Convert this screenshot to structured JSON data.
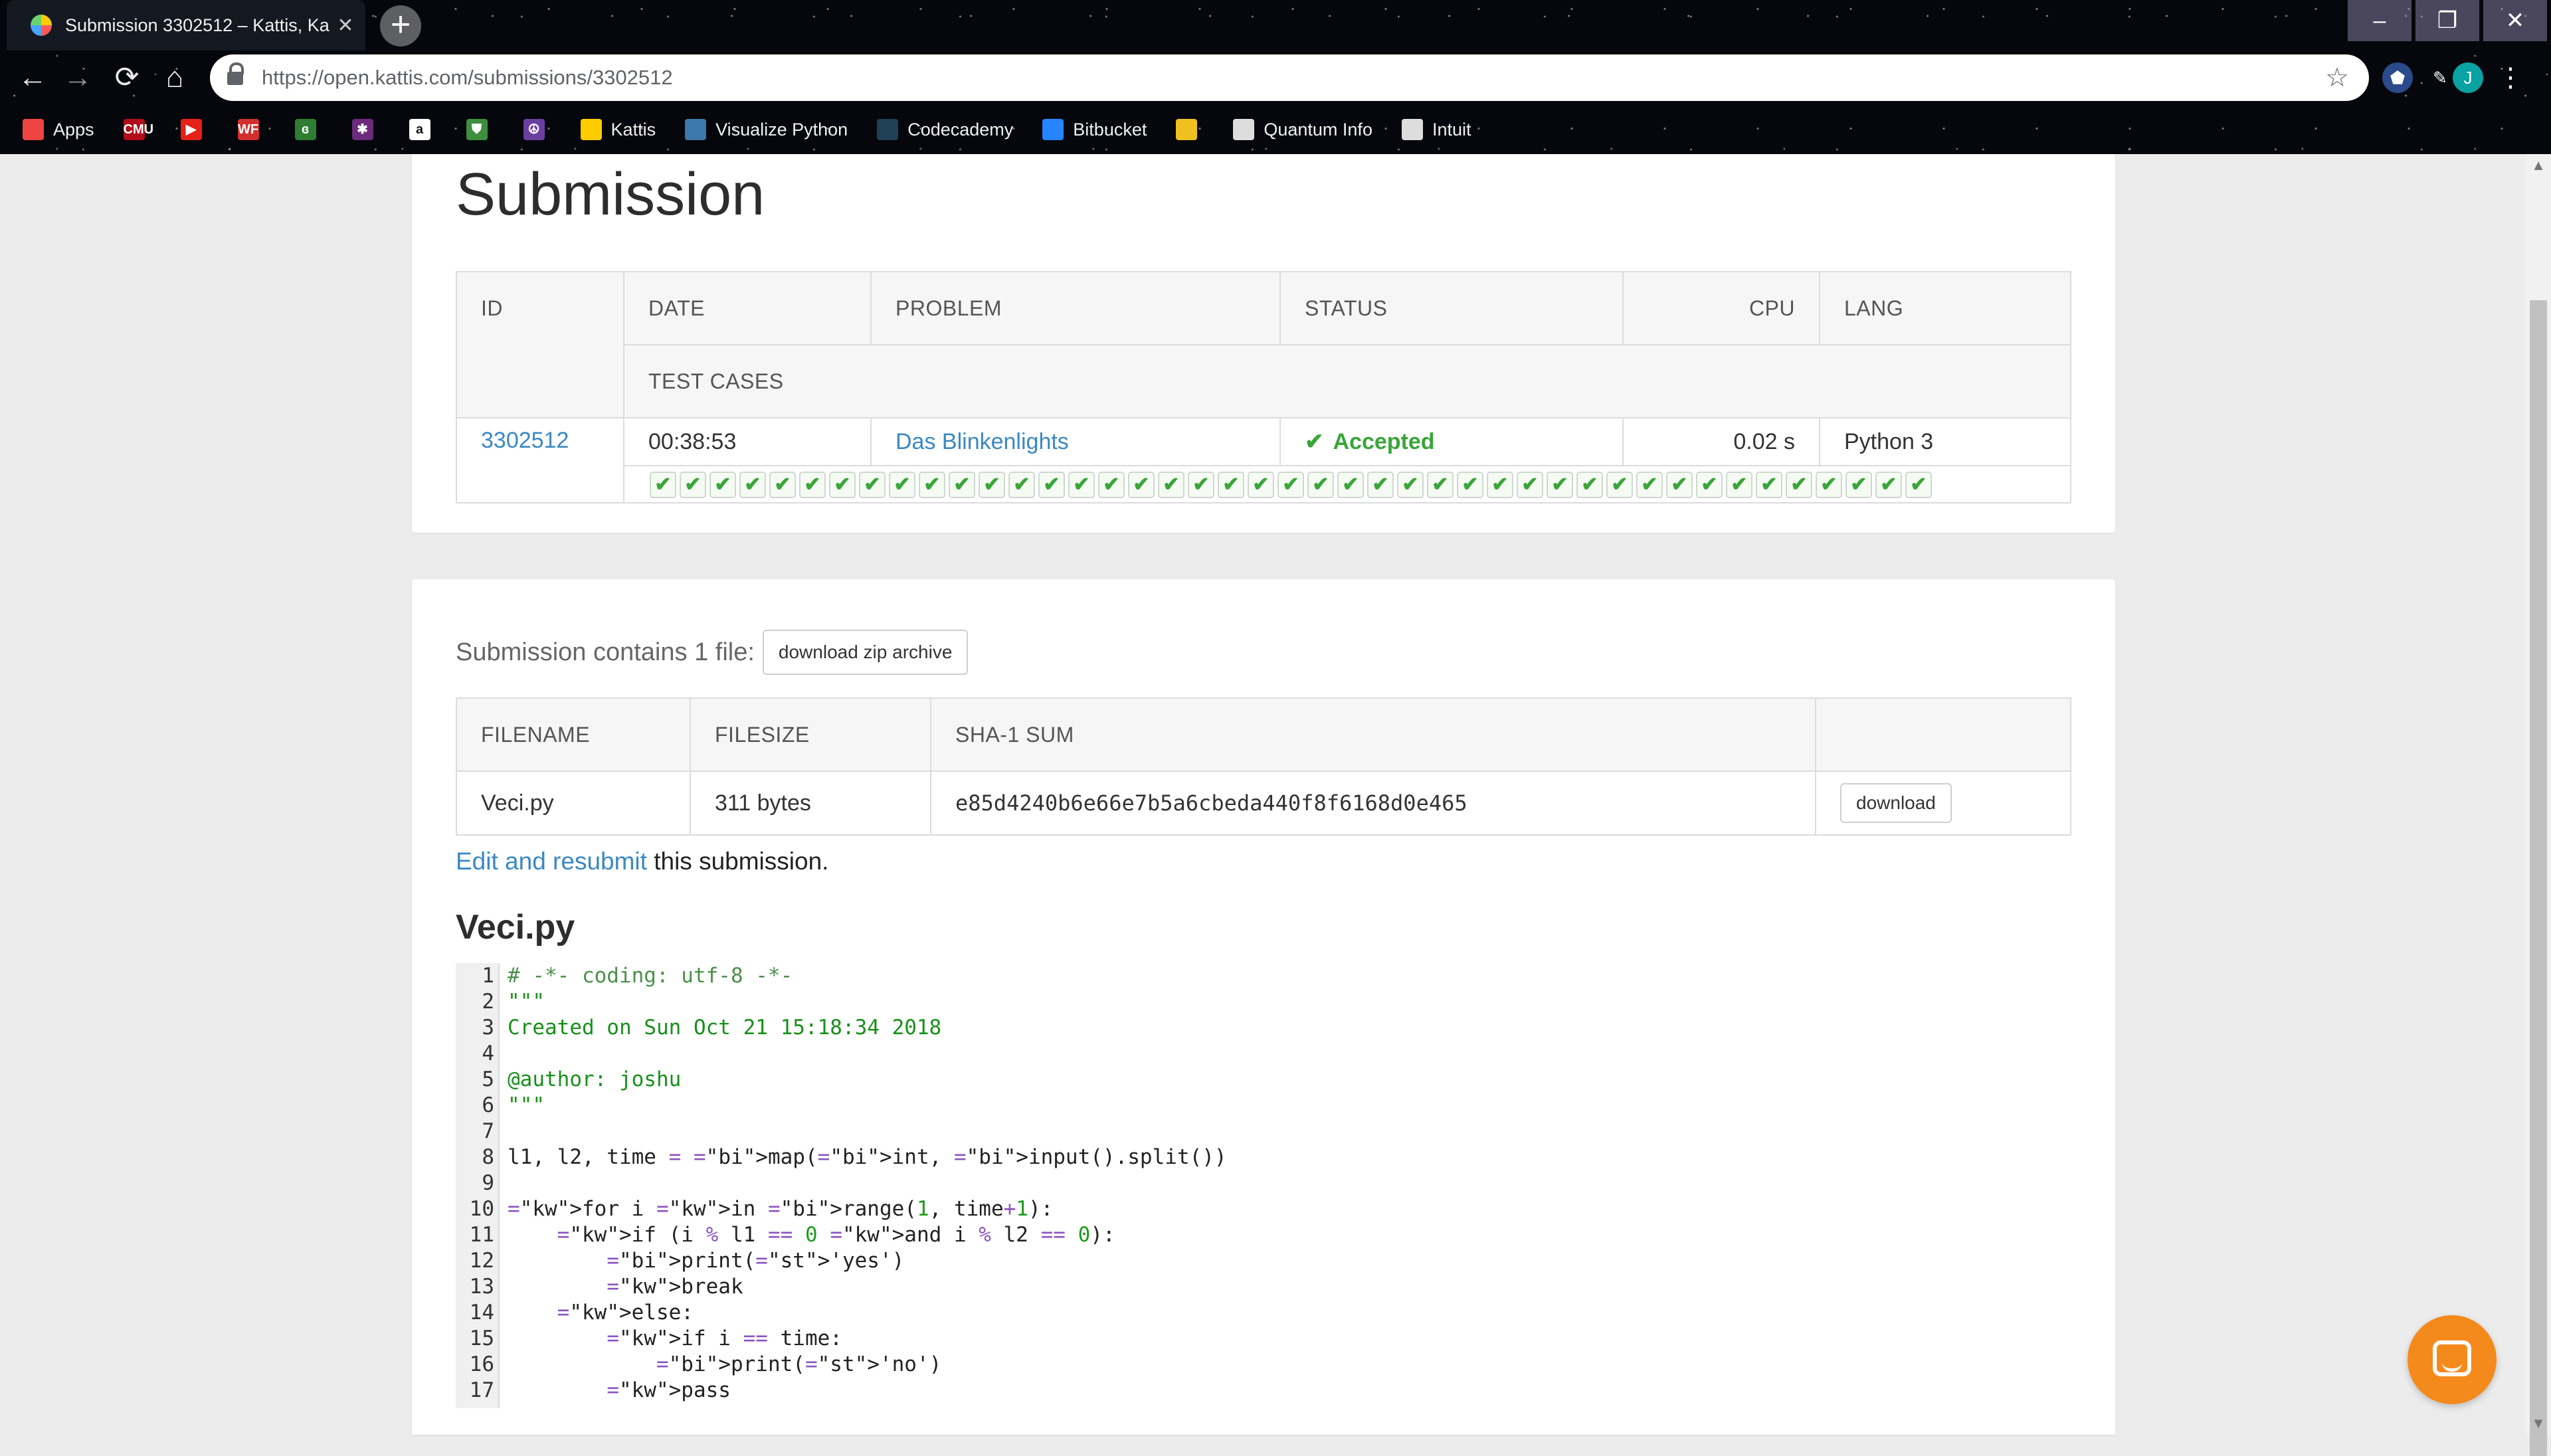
{
  "browser": {
    "tab_title": "Submission 3302512 – Kattis, Ka",
    "tab_close": "✕",
    "new_tab": "+",
    "url": "https://open.kattis.com/submissions/3302512",
    "bookmarks": [
      {
        "label": "Apps",
        "icon": "apps-grid-icon",
        "color": "#e44"
      },
      {
        "label": "",
        "icon": "cmu-icon",
        "color": "#b10d1a",
        "glyph": "CMU"
      },
      {
        "label": "",
        "icon": "youtube-icon",
        "color": "#e62117",
        "glyph": "▶"
      },
      {
        "label": "",
        "icon": "wf-icon",
        "color": "#d32f2f",
        "glyph": "WF"
      },
      {
        "label": "",
        "icon": "green-leaf-icon",
        "color": "#2e7d32",
        "glyph": "ɞ"
      },
      {
        "label": "",
        "icon": "slack-icon",
        "color": "#6b2a7a",
        "glyph": "✱"
      },
      {
        "label": "",
        "icon": "amazon-icon",
        "color": "#ffffff",
        "glyph": "a"
      },
      {
        "label": "",
        "icon": "shield-icon",
        "color": "#3d8f3d",
        "glyph": "⛊"
      },
      {
        "label": "",
        "icon": "peace-icon",
        "color": "#6a3fa0",
        "glyph": "☮"
      },
      {
        "label": "Kattis",
        "icon": "kattis-icon",
        "color": "#ffcc00"
      },
      {
        "label": "Visualize Python",
        "icon": "python-icon",
        "color": "#3c78aa"
      },
      {
        "label": "Codecademy",
        "icon": "codecademy-icon",
        "color": "#1f4056"
      },
      {
        "label": "Bitbucket",
        "icon": "bitbucket-icon",
        "color": "#2684ff"
      },
      {
        "label": "",
        "icon": "tokens-icon",
        "color": "#f0c020"
      },
      {
        "label": "Quantum Info",
        "icon": "page-icon",
        "color": "#dddddd"
      },
      {
        "label": "Intuit",
        "icon": "page-icon",
        "color": "#dddddd"
      }
    ],
    "profile_initial": "J"
  },
  "page": {
    "title": "Submission",
    "summary_table": {
      "headers": {
        "id": "ID",
        "date": "DATE",
        "problem": "PROBLEM",
        "status": "STATUS",
        "cpu": "CPU",
        "lang": "LANG",
        "test_cases": "TEST CASES"
      },
      "row": {
        "id": "3302512",
        "date": "00:38:53",
        "problem": "Das Blinkenlights",
        "status": "Accepted",
        "cpu": "0.02 s",
        "lang": "Python 3"
      },
      "test_cases_passed": 43,
      "check_glyph": "✔"
    },
    "files_section": {
      "contains_text": "Submission contains 1 file:",
      "download_zip": "download zip archive",
      "headers": {
        "filename": "FILENAME",
        "filesize": "FILESIZE",
        "sha1": "SHA-1 SUM",
        "action": ""
      },
      "row": {
        "filename": "Veci.py",
        "filesize": "311 bytes",
        "sha1": "e85d4240b6e66e7b5a6cbeda440f8f6168d0e465",
        "download": "download"
      }
    },
    "resubmit": {
      "link": "Edit and resubmit",
      "rest": " this submission."
    },
    "file_heading": "Veci.py"
  },
  "code_lines": [
    "# -*- coding: utf-8 -*-",
    "\"\"\"",
    "Created on Sun Oct 21 15:18:34 2018",
    "",
    "@author: joshu",
    "\"\"\"",
    "",
    "l1, l2, time = map(int, input().split())",
    "",
    "for i in range(1, time+1):",
    "    if (i % l1 == 0 and i % l2 == 0):",
    "        print('yes')",
    "        break",
    "    else:",
    "        if i == time:",
    "            print('no')",
    "        pass"
  ],
  "colors": {
    "link": "#3b88c3",
    "accepted": "#3aa53a",
    "chat": "#f58a1c"
  }
}
